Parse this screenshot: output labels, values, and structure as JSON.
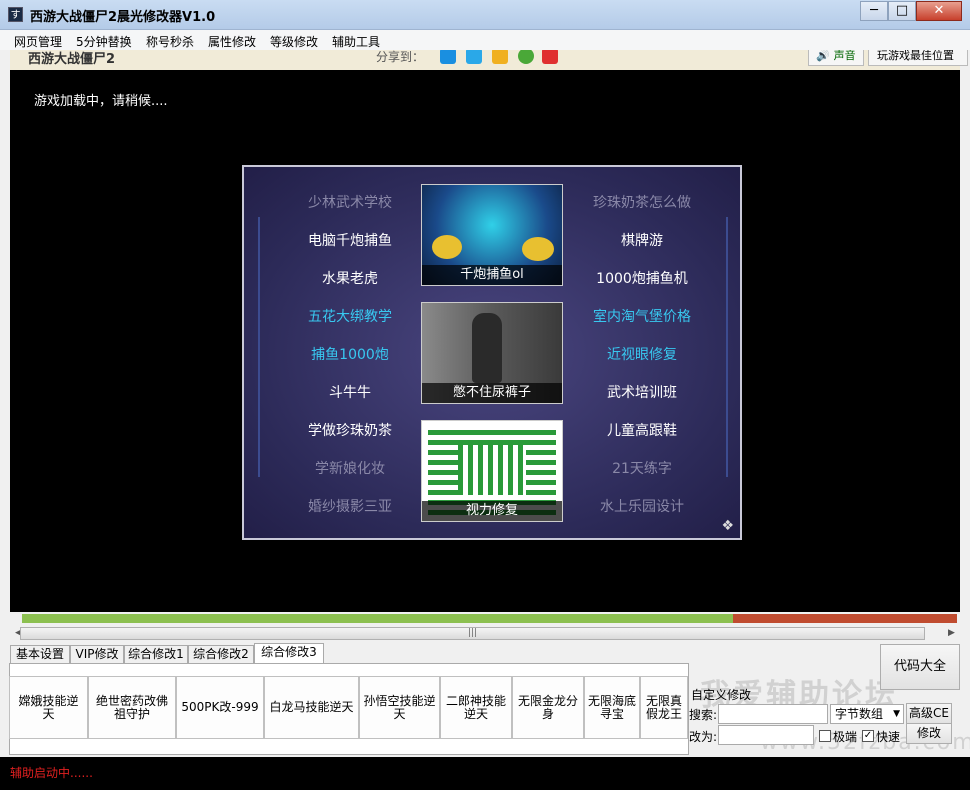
{
  "window": {
    "title": "西游大战僵尸2晨光修改器V1.0",
    "icon": "app-icon",
    "min": "─",
    "max": "□",
    "close": "✕"
  },
  "menu": [
    "网页管理",
    "5分钟替换",
    "称号秒杀",
    "属性修改",
    "等级修改",
    "辅助工具"
  ],
  "web_header": {
    "site_title": "西游大战僵尸2",
    "share_label": "分享到：",
    "sound_label": "🔊 声音",
    "best_position_label": "玩游戏最佳位置"
  },
  "game": {
    "loading_text": "游戏加载中，请稍候....",
    "ad": {
      "left": [
        {
          "text": "少林武术学校",
          "style": "dim"
        },
        {
          "text": "电脑千炮捕鱼",
          "style": "white"
        },
        {
          "text": "水果老虎",
          "style": "white"
        },
        {
          "text": "五花大绑教学",
          "style": "cyan"
        },
        {
          "text": "捕鱼1000炮",
          "style": "cyan"
        },
        {
          "text": "斗牛牛",
          "style": "white"
        },
        {
          "text": "学做珍珠奶茶",
          "style": "white"
        },
        {
          "text": "学新娘化妆",
          "style": "dim"
        },
        {
          "text": "婚纱摄影三亚",
          "style": "dim"
        }
      ],
      "right": [
        {
          "text": "珍珠奶茶怎么做",
          "style": "dim"
        },
        {
          "text": "棋牌游",
          "style": "white"
        },
        {
          "text": "1000炮捕鱼机",
          "style": "white"
        },
        {
          "text": "室内淘气堡价格",
          "style": "cyan"
        },
        {
          "text": "近视眼修复",
          "style": "cyan"
        },
        {
          "text": "武术培训班",
          "style": "white"
        },
        {
          "text": "儿童高跟鞋",
          "style": "white"
        },
        {
          "text": "21天练字",
          "style": "dim"
        },
        {
          "text": "水上乐园设计",
          "style": "dim"
        }
      ],
      "thumbs": [
        "千炮捕鱼ol",
        "憋不住尿裤子",
        "视力修复"
      ]
    }
  },
  "progress": {
    "fraction": 0.76
  },
  "tabs": [
    "基本设置",
    "VIP修改",
    "综合修改1",
    "综合修改2",
    "综合修改3"
  ],
  "active_tab": 4,
  "feature_buttons": [
    "嫦娥技能逆天",
    "绝世密药改佛祖守护",
    "500PK改-999",
    "白龙马技能逆天",
    "孙悟空技能逆天",
    "二郎神技能逆天",
    "无限金龙分身",
    "无限海底寻宝",
    "无限真假龙王"
  ],
  "code_button": "代码大全",
  "custom": {
    "title": "自定义修改",
    "search_label": "搜索:",
    "change_label": "改为:",
    "type_select": "字节数组",
    "advanced_ce": "高级CE",
    "extreme_label": "极端",
    "fast_label": "快速",
    "fast_checked": true,
    "extreme_checked": false,
    "modify_button": "修改"
  },
  "watermark": {
    "text": "我爱辅助论坛",
    "url": "www.52fzba.com"
  },
  "status": "辅助启动中......"
}
